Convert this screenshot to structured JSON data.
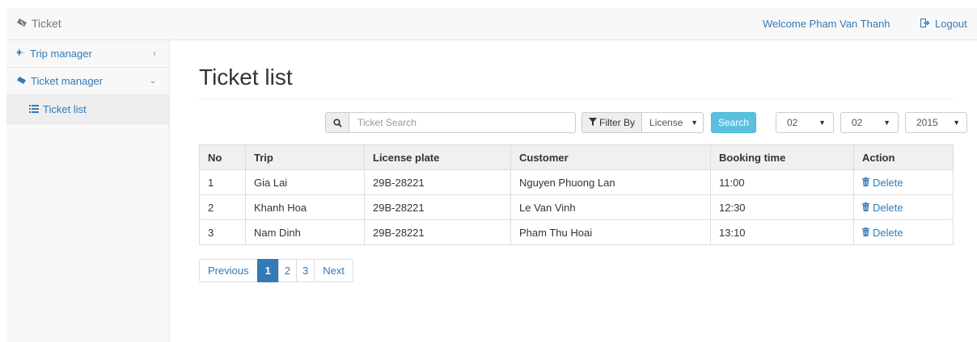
{
  "header": {
    "brand": "Ticket",
    "welcome": "Welcome Pham Van Thanh",
    "logout": "Logout"
  },
  "sidebar": {
    "items": [
      {
        "label": "Trip manager",
        "icon": "plane-icon",
        "chevron": "chevron-left-icon"
      },
      {
        "label": "Ticket manager",
        "icon": "ticket-icon",
        "chevron": "chevron-down-icon"
      }
    ],
    "sub_items": [
      {
        "label": "Ticket list",
        "icon": "list-icon"
      }
    ]
  },
  "main": {
    "title": "Ticket list",
    "search": {
      "placeholder": "Ticket Search",
      "value": ""
    },
    "filter": {
      "button_label": "Filter By",
      "selected": "License"
    },
    "search_button": "Search",
    "date": {
      "day": "02",
      "month": "02",
      "year": "2015"
    }
  },
  "table": {
    "columns": [
      "No",
      "Trip",
      "License plate",
      "Customer",
      "Booking time",
      "Action"
    ],
    "rows": [
      {
        "no": "1",
        "trip": "Gia Lai",
        "plate": "29B-28221",
        "customer": "Nguyen Phuong Lan",
        "time": "11:00",
        "action": "Delete"
      },
      {
        "no": "2",
        "trip": "Khanh Hoa",
        "plate": "29B-28221",
        "customer": "Le Van Vinh",
        "time": "12:30",
        "action": "Delete"
      },
      {
        "no": "3",
        "trip": "Nam Dinh",
        "plate": "29B-28221",
        "customer": "Pham Thu Hoai",
        "time": "13:10",
        "action": "Delete"
      }
    ]
  },
  "pagination": {
    "previous": "Previous",
    "pages": [
      "1",
      "2",
      "3"
    ],
    "active": "1",
    "next": "Next"
  },
  "colors": {
    "link": "#337ab7",
    "info_button": "#5bc0de",
    "active_page": "#337ab7"
  }
}
